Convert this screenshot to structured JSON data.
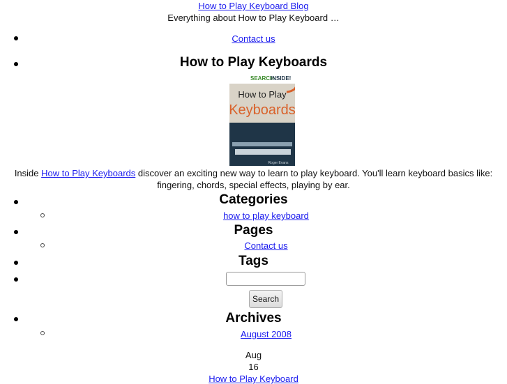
{
  "header": {
    "blog_title": "How to Play Keyboard Blog",
    "tagline": "Everything about How to Play Keyboard …"
  },
  "nav": {
    "contact_link": "Contact us"
  },
  "featured": {
    "heading": "How to Play Keyboards",
    "cover": {
      "badge": "SEARCH INSIDE!™",
      "title_line1": "How to Play",
      "title_line2": "Keyboards",
      "author": "Roger Evans"
    },
    "description_prefix": "Inside ",
    "description_link": "How to Play Keyboards",
    "description_line1": " discover an exciting new way to learn to play keyboard. You'll learn keyboard basics like:",
    "description_line2": "fingering, chords, special effects, playing by ear."
  },
  "sidebar": {
    "categories": {
      "heading": "Categories",
      "items": [
        "how to play keyboard"
      ]
    },
    "pages": {
      "heading": "Pages",
      "items": [
        "Contact us"
      ]
    },
    "tags": {
      "heading": "Tags"
    },
    "search": {
      "value": "",
      "placeholder": "",
      "button_label": "Search"
    },
    "archives": {
      "heading": "Archives",
      "items": [
        "August 2008"
      ]
    }
  },
  "post": {
    "month": "Aug",
    "day": "16",
    "title": "How to Play Keyboard"
  },
  "colors": {
    "link": "#1a1aee",
    "cover_orange": "#d9622b",
    "cover_navy": "#1f3547",
    "cover_bg": "#d9d3c7"
  }
}
